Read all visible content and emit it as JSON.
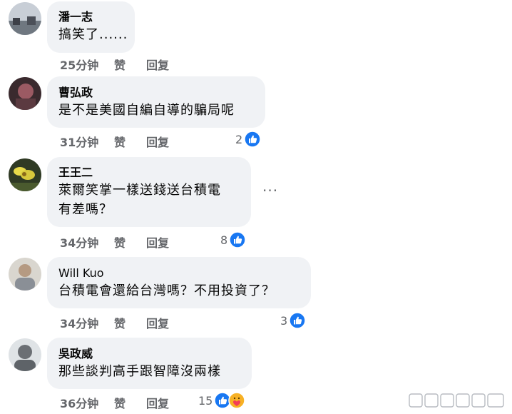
{
  "comments": [
    {
      "name": "潘一志",
      "text_lines": [
        "搞笑了......"
      ],
      "time": "25分钟",
      "like_label": "赞",
      "reply_label": "回复",
      "reaction_count": ""
    },
    {
      "name": "曹弘政",
      "text_lines": [
        "是不是美國自編自導的騙局呢"
      ],
      "time": "31分钟",
      "like_label": "赞",
      "reply_label": "回复",
      "reaction_count": "2"
    },
    {
      "name": "王王二",
      "text_lines": [
        "萊爾笑掌一樣送錢送台積電",
        "有差嗎？"
      ],
      "time": "34分钟",
      "like_label": "赞",
      "reply_label": "回复",
      "reaction_count": "8",
      "more_label": "···"
    },
    {
      "name": "Will Kuo",
      "text_lines": [
        "台積電會還給台灣嗎？不用投資了？"
      ],
      "time": "34分钟",
      "like_label": "赞",
      "reply_label": "回复",
      "reaction_count": "3"
    },
    {
      "name": "吳政威",
      "text_lines": [
        "那些談判高手跟智障沒兩樣"
      ],
      "time": "36分钟",
      "like_label": "赞",
      "reply_label": "回复",
      "reaction_count": "15"
    }
  ],
  "icons": {
    "like": "like-reaction-icon",
    "care": "care-reaction-icon"
  },
  "colors": {
    "bubble": "#f0f2f5",
    "meta": "#65676b",
    "like_blue": "#1877f2",
    "care_yellow": "#f7b125"
  }
}
